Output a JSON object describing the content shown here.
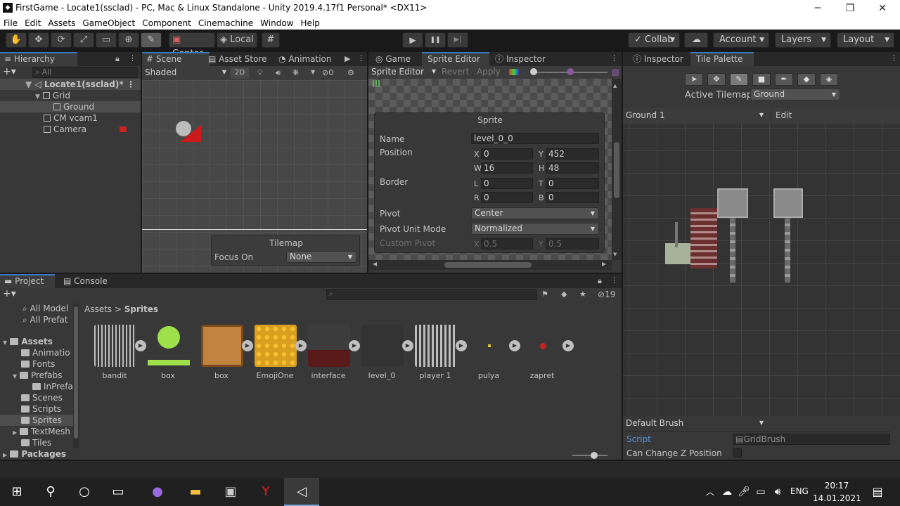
{
  "window": {
    "title": "FirstGame - Locate1(ssclad) - PC, Mac & Linux Standalone - Unity 2019.4.17f1 Personal* <DX11>",
    "app_icon": "unity-icon",
    "minimize": "─",
    "maximize": "❐",
    "close": "✕"
  },
  "menu": [
    "File",
    "Edit",
    "Assets",
    "GameObject",
    "Component",
    "Cinemachine",
    "Window",
    "Help"
  ],
  "toolbar": {
    "tools": [
      "hand-tool-icon",
      "move-tool-icon",
      "rotate-tool-icon",
      "scale-tool-icon",
      "rect-tool-icon",
      "transform-tool-icon",
      "custom-tool-icon"
    ],
    "pivot": "Center",
    "space": "Local",
    "play": "▶",
    "pause": "❚❚",
    "step": "▶|",
    "collab": "Collab",
    "account": "Account",
    "layers": "Layers",
    "layout": "Layout"
  },
  "hierarchy": {
    "tab": "Hierarchy",
    "search_placeholder": "All",
    "scene": "Locate1(ssclad)*",
    "items": [
      {
        "label": "Grid"
      },
      {
        "label": "Ground"
      },
      {
        "label": "CM vcam1"
      },
      {
        "label": "Camera"
      }
    ]
  },
  "scene_tabs": {
    "scene": "Scene",
    "asset_store": "Asset Store",
    "animation": "Animation"
  },
  "scene_toolbar": {
    "shading": "Shaded",
    "mode2d": "2D",
    "hidden_count": "0"
  },
  "tilemap_overlay": {
    "title": "Tilemap",
    "focus_label": "Focus On",
    "focus_value": "None"
  },
  "sprite_editor": {
    "tabs": {
      "game": "Game",
      "sprite_editor": "Sprite Editor",
      "inspector": "Inspector"
    },
    "toolbar": {
      "mode": "Sprite Editor",
      "revert": "Revert",
      "apply": "Apply"
    },
    "panel_title": "Sprite",
    "name_label": "Name",
    "name_value": "level_0_0",
    "position_label": "Position",
    "x_label": "X",
    "x_value": "0",
    "y_label": "Y",
    "y_value": "452",
    "w_label": "W",
    "w_value": "16",
    "h_label": "H",
    "h_value": "48",
    "border_label": "Border",
    "l_label": "L",
    "l_value": "0",
    "t_label": "T",
    "t_value": "0",
    "r_label": "R",
    "r_value": "0",
    "b_label": "B",
    "b_value": "0",
    "pivot_label": "Pivot",
    "pivot_value": "Center",
    "pivot_unit_label": "Pivot Unit Mode",
    "pivot_unit_value": "Normalized",
    "custom_pivot_label": "Custom Pivot",
    "cp_x_label": "X",
    "cp_x_value": "0.5",
    "cp_y_label": "Y",
    "cp_y_value": "0.5"
  },
  "right_panel": {
    "tab_inspector": "Inspector",
    "tab_tile_palette": "Tile Palette",
    "active_tilemap_label": "Active Tilemap",
    "active_tilemap_value": "Ground",
    "palette_value": "Ground 1",
    "edit_label": "Edit",
    "brush_value": "Default Brush",
    "script_label": "Script",
    "script_value": "GridBrush",
    "can_change_z_label": "Can Change Z Position"
  },
  "project": {
    "tab_project": "Project",
    "tab_console": "Console",
    "hidden_count": "19",
    "breadcrumb_root": "Assets",
    "breadcrumb_sep": ">",
    "breadcrumb_current": "Sprites",
    "favorites": [
      "All Model",
      "All Prefat"
    ],
    "tree": [
      {
        "label": "Assets"
      },
      {
        "label": "Animatio"
      },
      {
        "label": "Fonts"
      },
      {
        "label": "Prefabs"
      },
      {
        "label": "InPrefa"
      },
      {
        "label": "Scenes"
      },
      {
        "label": "Scripts"
      },
      {
        "label": "Sprites"
      },
      {
        "label": "TextMesh"
      },
      {
        "label": "Tiles"
      },
      {
        "label": "Packages"
      }
    ],
    "assets": [
      {
        "name": "bandit"
      },
      {
        "name": "box"
      },
      {
        "name": "box"
      },
      {
        "name": "EmojiOne"
      },
      {
        "name": "interface"
      },
      {
        "name": "level_0"
      },
      {
        "name": "player 1"
      },
      {
        "name": "pulya"
      },
      {
        "name": "zapret"
      }
    ]
  },
  "taskbar": {
    "language": "ENG",
    "time": "20:17",
    "date": "14.01.2021"
  }
}
